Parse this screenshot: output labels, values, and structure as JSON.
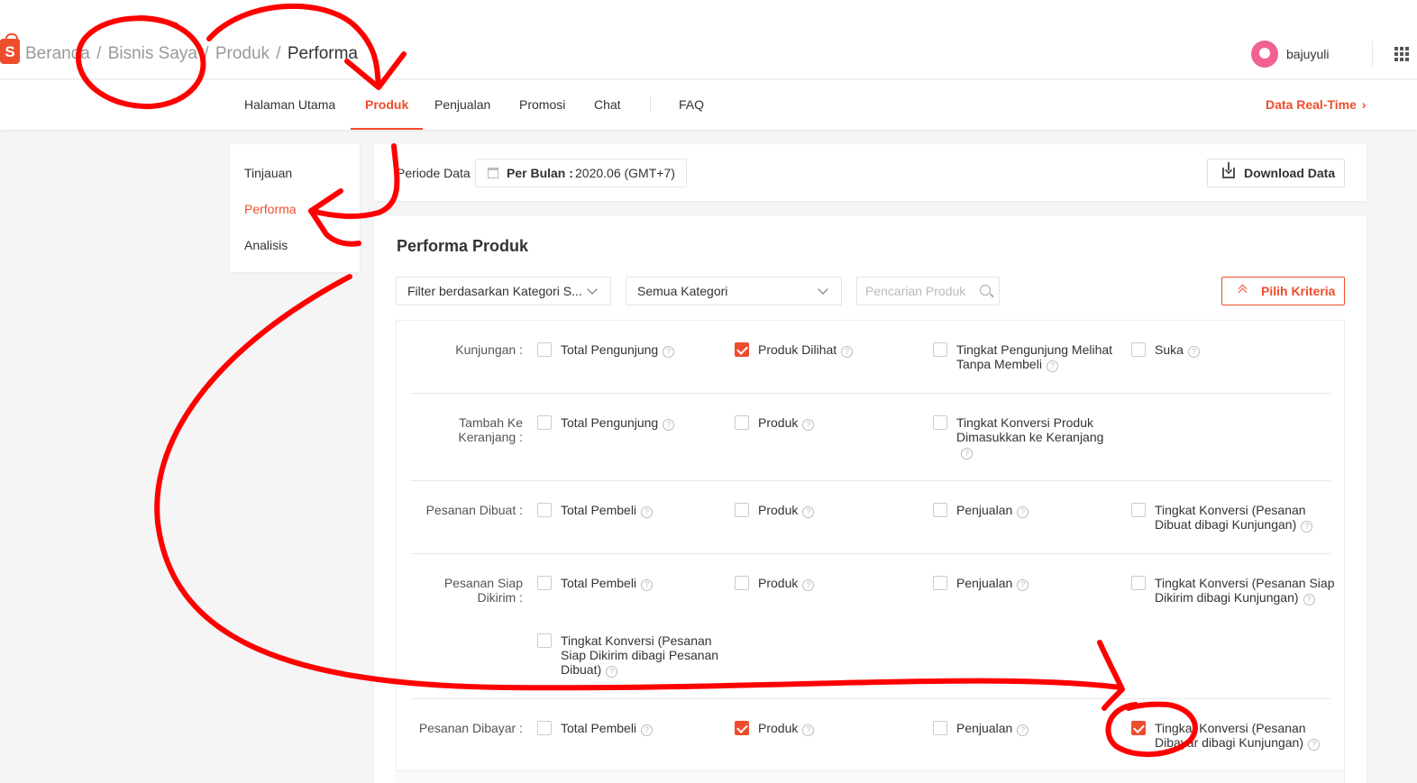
{
  "breadcrumb": {
    "items": [
      "Beranda",
      "Bisnis Saya",
      "Produk"
    ],
    "separator": "/",
    "current": "Performa"
  },
  "user": {
    "name": "bajuyuli"
  },
  "nav": {
    "tabs": [
      "Halaman Utama",
      "Produk",
      "Penjualan",
      "Promosi",
      "Chat",
      "FAQ"
    ],
    "active": "Produk",
    "realtime_label": "Data Real-Time"
  },
  "sidemenu": {
    "items": [
      "Tinjauan",
      "Performa",
      "Analisis"
    ],
    "active": "Performa"
  },
  "period": {
    "label": "Periode Data",
    "type_label": "Per Bulan :",
    "value": "2020.06 (GMT+7)"
  },
  "download_label": "Download Data",
  "main": {
    "title": "Performa Produk",
    "filter_category_select": "Filter berdasarkan Kategori S...",
    "category_select": "Semua Kategori",
    "search_placeholder": "Pencarian Produk",
    "criteria_button": "Pilih Kriteria"
  },
  "criteria": [
    {
      "label": "Kunjungan :",
      "options": [
        {
          "text": "Total Pengunjung",
          "checked": false
        },
        {
          "text": "Produk Dilihat",
          "checked": true
        },
        {
          "text": "Tingkat Pengunjung Melihat Tanpa Membeli",
          "checked": false
        },
        {
          "text": "Suka",
          "checked": false
        }
      ]
    },
    {
      "label": "Tambah Ke Keranjang :",
      "options": [
        {
          "text": "Total Pengunjung",
          "checked": false
        },
        {
          "text": "Produk",
          "checked": false
        },
        {
          "text": "Tingkat Konversi Produk Dimasukkan ke Keranjang",
          "checked": false
        }
      ]
    },
    {
      "label": "Pesanan Dibuat :",
      "options": [
        {
          "text": "Total Pembeli",
          "checked": false
        },
        {
          "text": "Produk",
          "checked": false
        },
        {
          "text": "Penjualan",
          "checked": false
        },
        {
          "text": "Tingkat Konversi (Pesanan Dibuat dibagi Kunjungan)",
          "checked": false
        }
      ]
    },
    {
      "label": "Pesanan Siap Dikirim :",
      "options": [
        {
          "text": "Total Pembeli",
          "checked": false
        },
        {
          "text": "Produk",
          "checked": false
        },
        {
          "text": "Penjualan",
          "checked": false
        },
        {
          "text": "Tingkat Konversi (Pesanan Siap Dikirim dibagi Kunjungan)",
          "checked": false
        },
        {
          "text": "Tingkat Konversi (Pesanan Siap Dikirim dibagi Pesanan Dibuat)",
          "checked": false
        }
      ]
    },
    {
      "label": "Pesanan Dibayar :",
      "options": [
        {
          "text": "Total Pembeli",
          "checked": false
        },
        {
          "text": "Produk",
          "checked": true
        },
        {
          "text": "Penjualan",
          "checked": false
        },
        {
          "text": "Tingkat Konversi (Pesanan Dibayar dibagi Kunjungan)",
          "checked": true
        }
      ]
    }
  ],
  "colors": {
    "accent": "#ee4d2d",
    "annotation": "#ff0000"
  }
}
